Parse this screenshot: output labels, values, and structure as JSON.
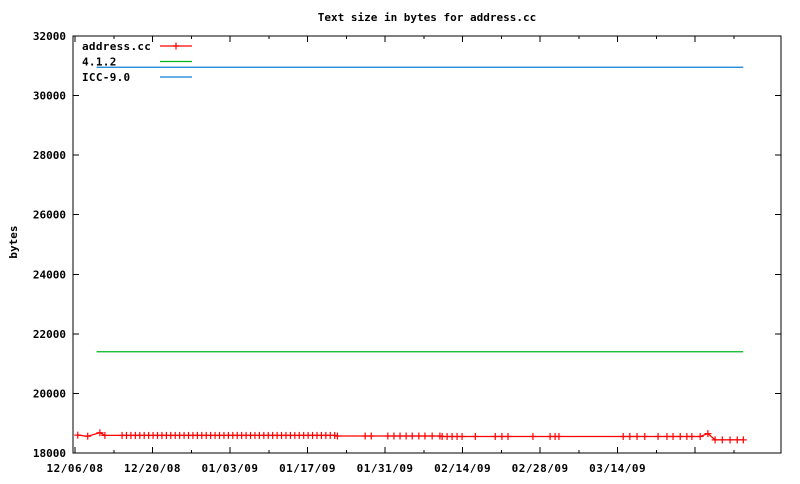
{
  "chart_data": {
    "type": "line",
    "title": "Text size in bytes for address.cc",
    "xlabel": "",
    "ylabel": "bytes",
    "x_unit": "days since 12/06/08",
    "xlim": [
      -0.36,
      127.5
    ],
    "ylim": [
      18000,
      32000
    ],
    "grid": false,
    "background": "#ffffff",
    "border_color": "#000000",
    "yticks": [
      {
        "value": 18000,
        "label": "18000"
      },
      {
        "value": 20000,
        "label": "20000"
      },
      {
        "value": 22000,
        "label": "22000"
      },
      {
        "value": 24000,
        "label": "24000"
      },
      {
        "value": 26000,
        "label": "26000"
      },
      {
        "value": 28000,
        "label": "28000"
      },
      {
        "value": 30000,
        "label": "30000"
      },
      {
        "value": 32000,
        "label": "32000"
      }
    ],
    "xticks": [
      {
        "day": 0,
        "label": "12/06/08"
      },
      {
        "day": 14,
        "label": "12/20/08"
      },
      {
        "day": 28,
        "label": "01/03/09"
      },
      {
        "day": 42,
        "label": "01/17/09"
      },
      {
        "day": 56,
        "label": "01/31/09"
      },
      {
        "day": 70,
        "label": "02/14/09"
      },
      {
        "day": 84,
        "label": "02/28/09"
      },
      {
        "day": 98,
        "label": "03/14/09"
      },
      {
        "day": 112,
        "label": ""
      }
    ],
    "xticks_minor": [
      7,
      21,
      35,
      49,
      63,
      77,
      91,
      105,
      119
    ],
    "legend": {
      "position": "top-left-inside",
      "entries": [
        {
          "name": "address.cc",
          "color": "#ff0000",
          "marker": "plus"
        },
        {
          "name": "4.1.2",
          "color": "#00b41e",
          "marker": "none"
        },
        {
          "name": "ICC-9.0",
          "color": "#0c7fd6",
          "marker": "none"
        }
      ]
    },
    "series": [
      {
        "name": "address.cc",
        "style": "linespoints",
        "marker": "plus",
        "color": "#ff0000",
        "points": [
          [
            0.5,
            18600
          ],
          [
            2.3,
            18565
          ],
          [
            4.5,
            18680
          ],
          [
            5.4,
            18590
          ],
          [
            8.5,
            18590
          ],
          [
            9.3,
            18590
          ],
          [
            10.1,
            18590
          ],
          [
            10.9,
            18590
          ],
          [
            11.7,
            18590
          ],
          [
            12.5,
            18590
          ],
          [
            13.3,
            18590
          ],
          [
            14.1,
            18590
          ],
          [
            14.9,
            18590
          ],
          [
            15.7,
            18590
          ],
          [
            16.5,
            18590
          ],
          [
            17.3,
            18590
          ],
          [
            18.1,
            18590
          ],
          [
            18.9,
            18590
          ],
          [
            19.7,
            18590
          ],
          [
            20.5,
            18590
          ],
          [
            21.3,
            18590
          ],
          [
            22.1,
            18590
          ],
          [
            22.9,
            18590
          ],
          [
            23.7,
            18590
          ],
          [
            24.5,
            18590
          ],
          [
            25.3,
            18590
          ],
          [
            26.1,
            18590
          ],
          [
            26.9,
            18590
          ],
          [
            27.7,
            18590
          ],
          [
            28.5,
            18590
          ],
          [
            29.3,
            18590
          ],
          [
            30.1,
            18590
          ],
          [
            30.9,
            18590
          ],
          [
            31.7,
            18590
          ],
          [
            32.5,
            18590
          ],
          [
            33.3,
            18590
          ],
          [
            34.1,
            18590
          ],
          [
            34.9,
            18590
          ],
          [
            35.7,
            18590
          ],
          [
            36.5,
            18590
          ],
          [
            37.3,
            18590
          ],
          [
            38.1,
            18590
          ],
          [
            38.9,
            18590
          ],
          [
            39.7,
            18590
          ],
          [
            40.5,
            18590
          ],
          [
            41.3,
            18590
          ],
          [
            42.1,
            18590
          ],
          [
            42.9,
            18590
          ],
          [
            43.7,
            18590
          ],
          [
            44.5,
            18590
          ],
          [
            45.3,
            18590
          ],
          [
            46.1,
            18590
          ],
          [
            46.9,
            18590
          ],
          [
            47.4,
            18570
          ],
          [
            52.4,
            18570
          ],
          [
            53.5,
            18570
          ],
          [
            56.5,
            18570
          ],
          [
            57.6,
            18570
          ],
          [
            58.7,
            18570
          ],
          [
            59.8,
            18570
          ],
          [
            60.9,
            18570
          ],
          [
            62.1,
            18570
          ],
          [
            63.2,
            18570
          ],
          [
            64.5,
            18570
          ],
          [
            65.9,
            18570
          ],
          [
            66.3,
            18555
          ],
          [
            67.2,
            18555
          ],
          [
            68.1,
            18555
          ],
          [
            69.0,
            18555
          ],
          [
            69.9,
            18555
          ],
          [
            72.3,
            18555
          ],
          [
            75.9,
            18555
          ],
          [
            77.1,
            18555
          ],
          [
            78.2,
            18555
          ],
          [
            82.7,
            18555
          ],
          [
            85.8,
            18555
          ],
          [
            86.7,
            18555
          ],
          [
            87.4,
            18555
          ],
          [
            99.0,
            18555
          ],
          [
            100.2,
            18555
          ],
          [
            101.5,
            18555
          ],
          [
            102.9,
            18555
          ],
          [
            105.3,
            18555
          ],
          [
            106.9,
            18555
          ],
          [
            108.0,
            18555
          ],
          [
            109.3,
            18555
          ],
          [
            110.5,
            18555
          ],
          [
            111.4,
            18555
          ],
          [
            112.9,
            18555
          ],
          [
            114.3,
            18650
          ],
          [
            115.6,
            18440
          ],
          [
            116.9,
            18440
          ],
          [
            118.3,
            18440
          ],
          [
            119.6,
            18440
          ],
          [
            120.7,
            18440
          ]
        ]
      },
      {
        "name": "4.1.2",
        "style": "line",
        "marker": "none",
        "color": "#00b41e",
        "points": [
          [
            3.9,
            21400
          ],
          [
            120.7,
            21400
          ]
        ]
      },
      {
        "name": "ICC-9.0",
        "style": "line",
        "marker": "none",
        "color": "#0c7fd6",
        "points": [
          [
            3.9,
            30950
          ],
          [
            120.7,
            30950
          ]
        ]
      }
    ]
  }
}
